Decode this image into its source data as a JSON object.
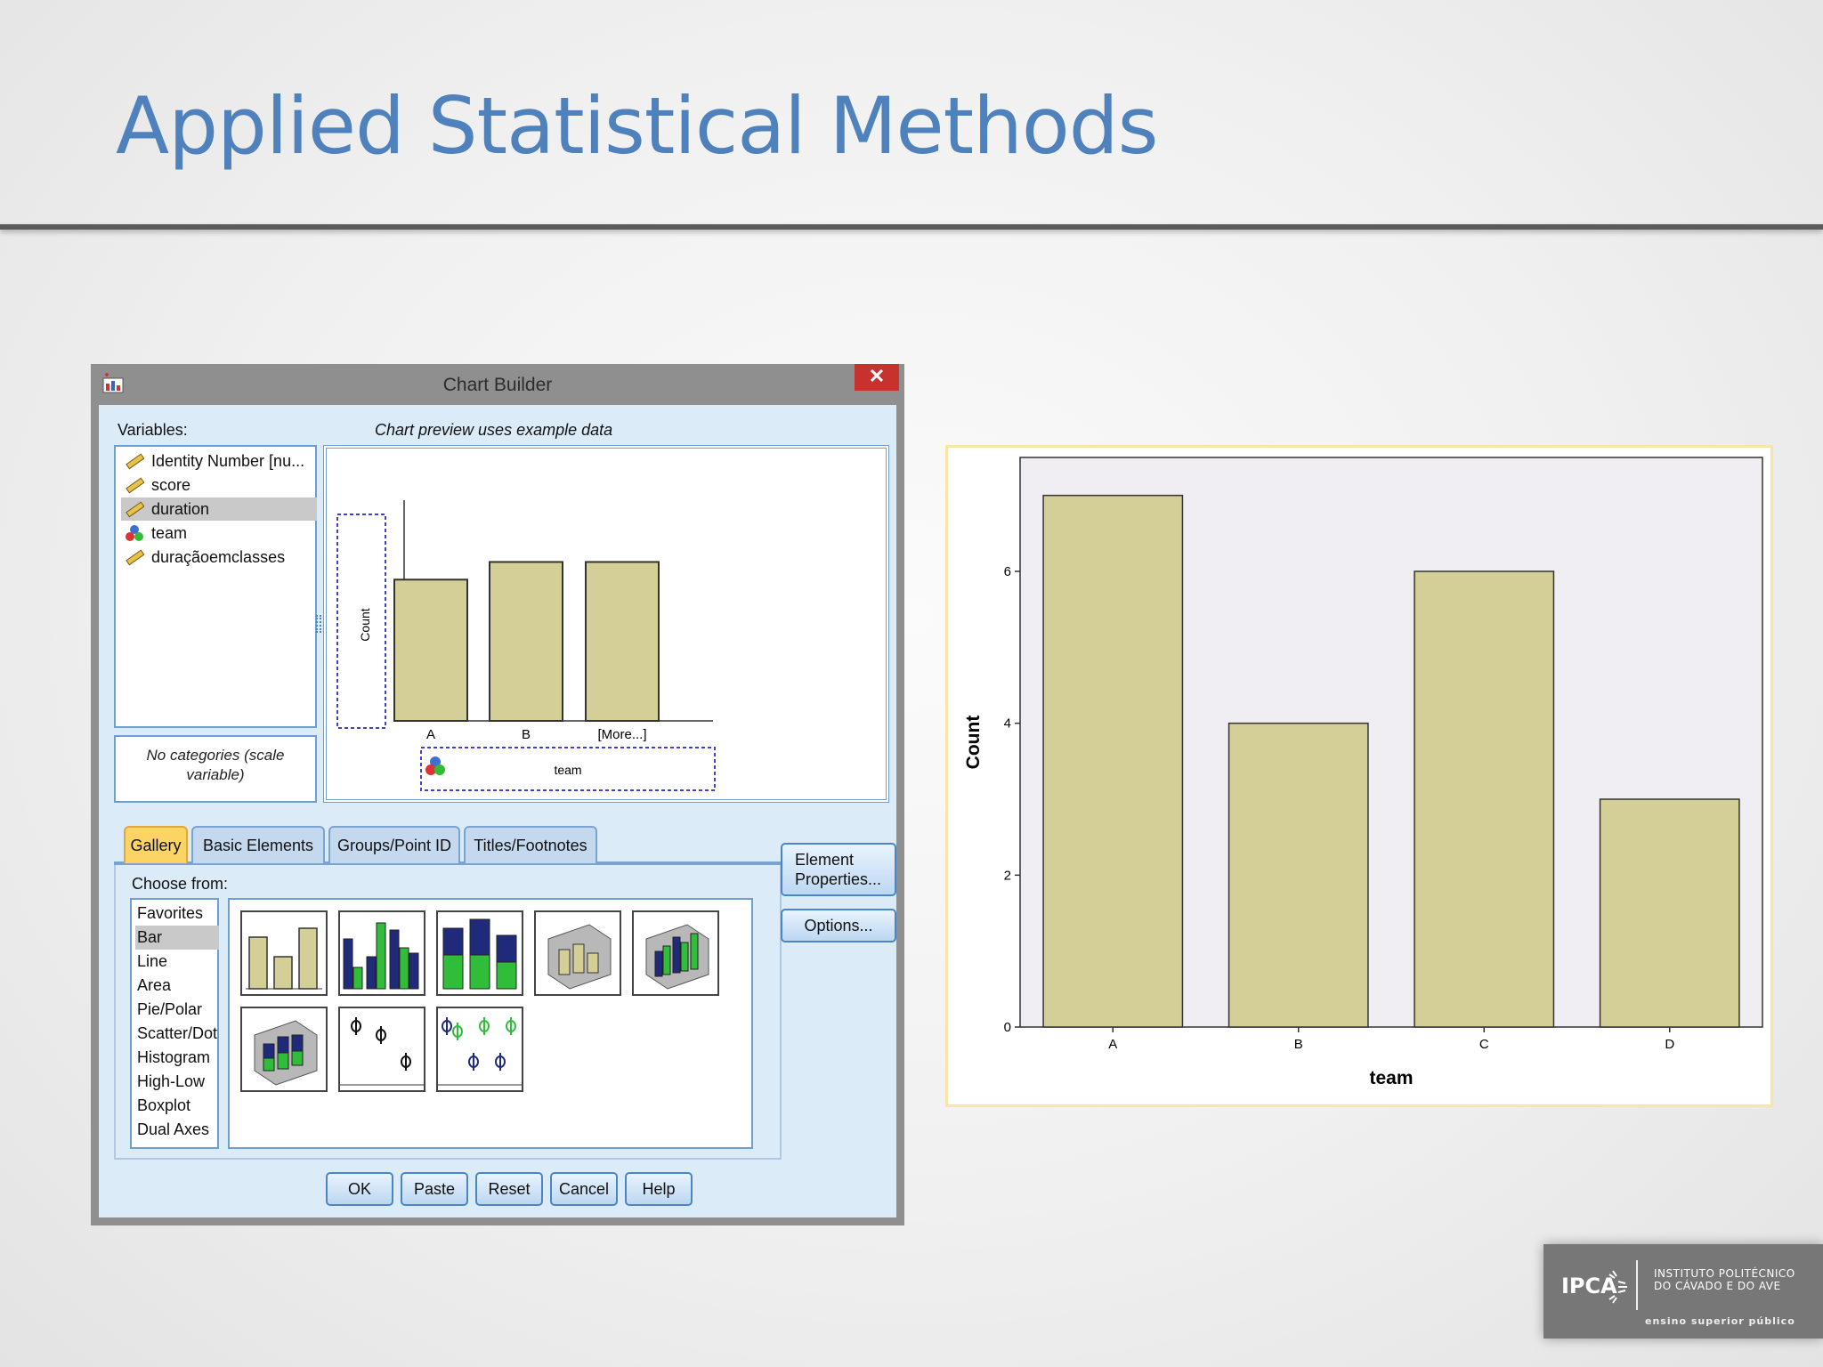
{
  "slide": {
    "title": "Applied Statistical Methods"
  },
  "dialog": {
    "title": "Chart Builder",
    "close": "✕",
    "variables_label": "Variables:",
    "variables": [
      {
        "label": "Identity Number  [nu...",
        "icon": "ruler-icon",
        "selected": false
      },
      {
        "label": "score",
        "icon": "ruler-icon",
        "selected": false
      },
      {
        "label": "duration",
        "icon": "ruler-icon",
        "selected": true
      },
      {
        "label": "team",
        "icon": "nominal-balls-icon",
        "selected": false
      },
      {
        "label": "duraçãoemclasses",
        "icon": "ruler-icon",
        "selected": false
      }
    ],
    "categories_note": "No categories (scale variable)",
    "preview_note": "Chart preview uses example data",
    "preview": {
      "y_axis_label": "Count",
      "categories": [
        "A",
        "B",
        "[More...]"
      ],
      "values": [
        0.64,
        0.72,
        0.72
      ],
      "x_drop_label": "team"
    },
    "tabs": [
      "Gallery",
      "Basic Elements",
      "Groups/Point ID",
      "Titles/Footnotes"
    ],
    "active_tab": "Gallery",
    "choose_from_label": "Choose from:",
    "gallery_types": [
      "Favorites",
      "Bar",
      "Line",
      "Area",
      "Pie/Polar",
      "Scatter/Dot",
      "Histogram",
      "High-Low",
      "Boxplot",
      "Dual Axes"
    ],
    "selected_type": "Bar",
    "side_buttons": {
      "element_properties": "Element Properties...",
      "options": "Options..."
    },
    "bottom_buttons": [
      "OK",
      "Paste",
      "Reset",
      "Cancel",
      "Help"
    ],
    "colors": {
      "bar_fill": "#d4cf96",
      "bar_blue": "#1f2a7a",
      "bar_green": "#2fbd3a",
      "tab_active": "#fbd463"
    }
  },
  "chart_data": {
    "type": "bar",
    "categories": [
      "A",
      "B",
      "C",
      "D"
    ],
    "values": [
      7,
      4,
      6,
      3
    ],
    "xlabel": "team",
    "ylabel": "Count",
    "ylim": [
      0,
      7.5
    ],
    "yticks": [
      0,
      2,
      4,
      6
    ],
    "bar_color": "#d4cf96",
    "plot_bg": "#f0eef2"
  },
  "logo": {
    "mark": "IPCA",
    "name_line1": "INSTITUTO POLITÉCNICO",
    "name_line2": "DO CÁVADO E DO AVE",
    "tagline": "ensino superior público"
  }
}
